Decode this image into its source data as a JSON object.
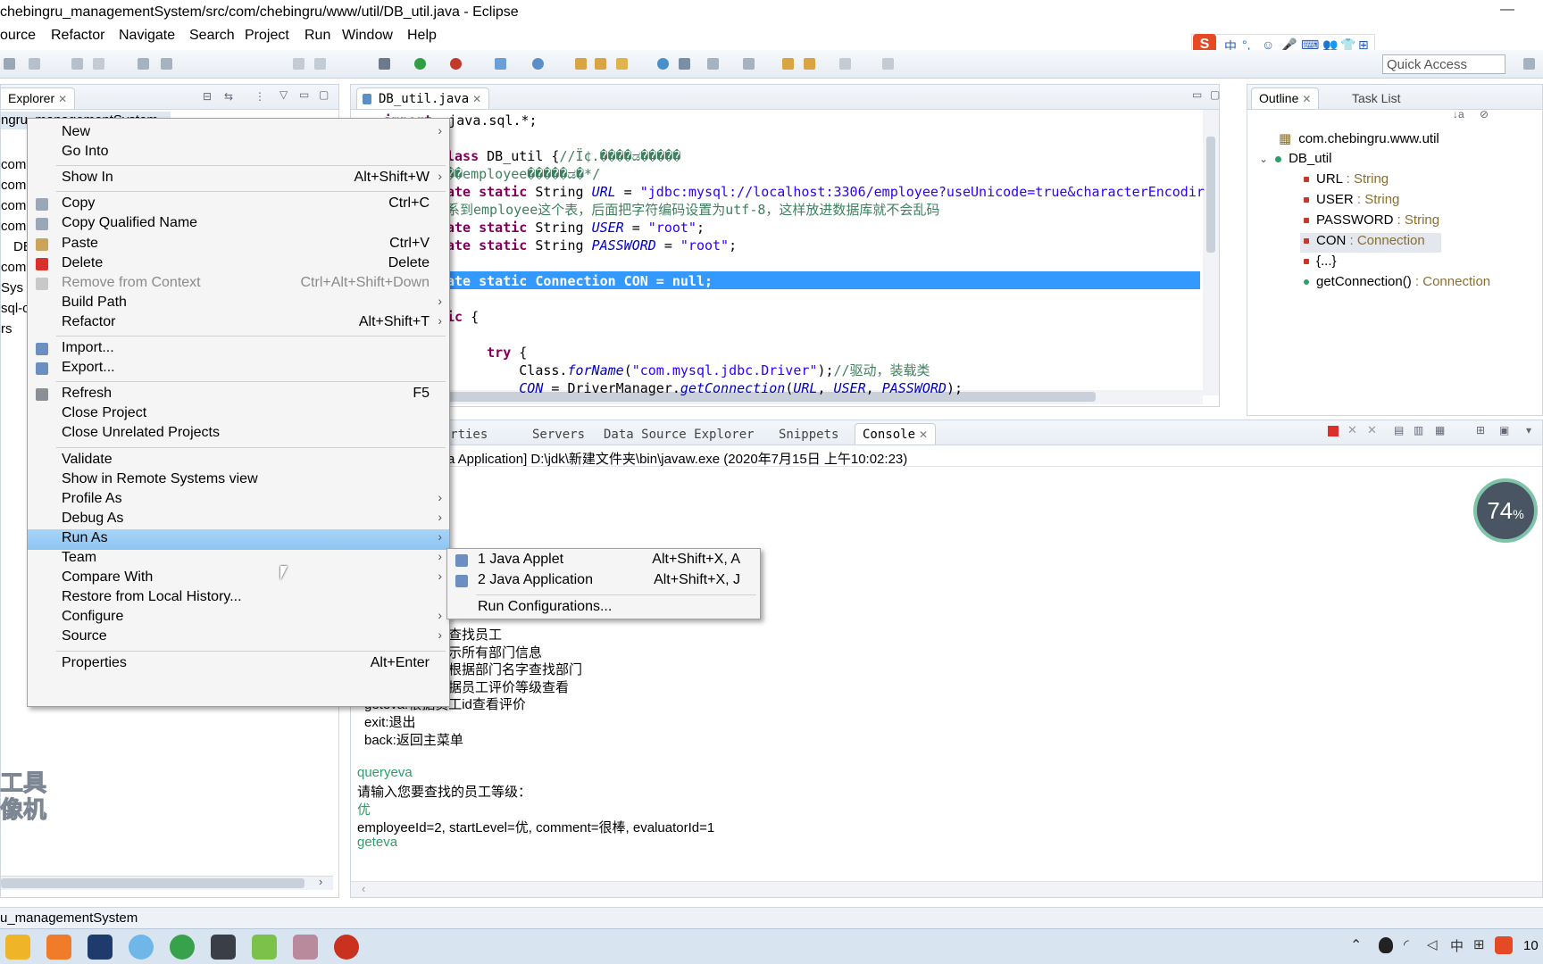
{
  "window": {
    "title": "chebingru_managementSystem/src/com/chebingru/www/util/DB_util.java - Eclipse",
    "minimize": "—"
  },
  "menubar": [
    "ource",
    "Refactor",
    "Navigate",
    "Search",
    "Project",
    "Run",
    "Window",
    "Help"
  ],
  "ime": {
    "logo": "S",
    "items": [
      "中",
      "°,",
      "☺",
      "🎤",
      "⌨",
      "👥",
      "👕",
      "⊞"
    ]
  },
  "toolbar": {
    "quick_access": "Quick Access"
  },
  "explorer": {
    "tab_label": "Explorer",
    "project_item": "ngru_managementSystem",
    "partial_rows": [
      "com.",
      "com.",
      "com.",
      "com.",
      "DB",
      "",
      "com.",
      "Sys",
      "sql-c",
      "",
      "rs"
    ],
    "watermark_line1": "工具",
    "watermark_line2": "像机"
  },
  "editor": {
    "tab_label": "DB_util.java",
    "lines": [
      {
        "parts": [
          [
            "kw",
            "import"
          ],
          [
            "",
            "  java.sql.*;"
          ]
        ]
      },
      {
        "parts": []
      },
      {
        "parts": [
          [
            "kw",
            "lass"
          ],
          [
            "",
            " DB_util {"
          ],
          [
            "cmt",
            "//Ï¢.����ಡ�����"
          ]
        ]
      },
      {
        "parts": [
          [
            "cmt",
            "��employee�����ಡ�*/"
          ]
        ]
      },
      {
        "parts": [
          [
            "kw",
            "ate static"
          ],
          [
            "",
            " String "
          ],
          [
            "fld",
            "URL"
          ],
          [
            "",
            " = "
          ],
          [
            "str",
            "\"jdbc:mysql://localhost:3306/employee?useUnicode=true&characterEncodir"
          ]
        ]
      },
      {
        "parts": [
          [
            "cmt",
            "系到employee这个表，后面把字符编码设置为utf-8，这样放进数据库就不会乱码"
          ]
        ]
      },
      {
        "parts": [
          [
            "kw",
            "ate static"
          ],
          [
            "",
            " String "
          ],
          [
            "fld",
            "USER"
          ],
          [
            "",
            " = "
          ],
          [
            "str",
            "\"root\""
          ],
          [
            "",
            ";"
          ]
        ]
      },
      {
        "parts": [
          [
            "kw",
            "ate static"
          ],
          [
            "",
            " String "
          ],
          [
            "fld",
            "PASSWORD"
          ],
          [
            "",
            " = "
          ],
          [
            "str",
            "\"root\""
          ],
          [
            "",
            ";"
          ]
        ]
      },
      {
        "parts": []
      },
      {
        "parts": [
          [
            "",
            "ate static Connection CON = null;"
          ]
        ]
      },
      {
        "parts": []
      },
      {
        "parts": [
          [
            "kw",
            "ic"
          ],
          [
            "",
            " {"
          ]
        ]
      },
      {
        "parts": []
      },
      {
        "parts": [
          [
            "",
            "     "
          ],
          [
            "kw",
            "try"
          ],
          [
            "",
            " {"
          ]
        ]
      },
      {
        "parts": [
          [
            "",
            "         Class."
          ],
          [
            "fld",
            "forName"
          ],
          [
            "",
            "("
          ],
          [
            "str",
            "\"com.mysql.jdbc.Driver\""
          ],
          [
            "",
            ");"
          ],
          [
            "cmt",
            "//驱动，装载类"
          ]
        ]
      },
      {
        "parts": [
          [
            "",
            "         "
          ],
          [
            "fld",
            "CON"
          ],
          [
            "",
            " = DriverManager."
          ],
          [
            "fld",
            "getConnection"
          ],
          [
            "",
            "("
          ],
          [
            "fld",
            "URL"
          ],
          [
            "",
            ", "
          ],
          [
            "fld",
            "USER"
          ],
          [
            "",
            ", "
          ],
          [
            "fld",
            "PASSWORD"
          ],
          [
            "",
            ");"
          ]
        ]
      }
    ]
  },
  "outline": {
    "tabs": [
      "Outline",
      "Task List"
    ],
    "package": "com.chebingru.www.util",
    "class": "DB_util",
    "members": [
      {
        "name": "URL",
        "type": " : String",
        "color": "#c0392b"
      },
      {
        "name": "USER",
        "type": " : String",
        "color": "#c0392b"
      },
      {
        "name": "PASSWORD",
        "type": " : String",
        "color": "#c0392b"
      },
      {
        "name": "CON",
        "type": " : Connection",
        "color": "#c0392b"
      },
      {
        "name": "{...}",
        "type": "",
        "color": "#c0392b"
      },
      {
        "name": "getConnection()",
        "type": " : Connection",
        "color": "#2ca06a"
      }
    ]
  },
  "console": {
    "tabs": [
      "Properties",
      "Servers",
      "Data Source Explorer",
      "Snippets",
      "Console"
    ],
    "header": "a Application] D:\\jdk\\新建文件夹\\bin\\javaw.exe (2020年7月15日 上午10:02:23)",
    "lines": [
      {
        "text": "查找员工",
        "green": false
      },
      {
        "text": "示所有部门信息",
        "green": false
      },
      {
        "text": "根据部门名字查找部门",
        "green": false
      },
      {
        "text": "据员工评价等级查看",
        "green": false
      },
      {
        "text": "geteva:根据员工id查看评价",
        "green": false
      },
      {
        "text": "exit:退出",
        "green": false
      },
      {
        "text": "back:返回主菜单",
        "green": false
      },
      {
        "text": "",
        "green": false
      },
      {
        "text": "queryeva",
        "green": true
      },
      {
        "text": "请输入您要查找的员工等级：",
        "green": false
      },
      {
        "text": "优",
        "green": true
      },
      {
        "text": "employeeId=2, startLevel=优, comment=很棒, evaluatorId=1",
        "green": false
      },
      {
        "text": "geteva",
        "green": true
      }
    ]
  },
  "context_menu": {
    "items": [
      {
        "label": "New",
        "shortcut": "",
        "submenu": true
      },
      {
        "label": "Go Into",
        "shortcut": ""
      },
      {
        "sep": true
      },
      {
        "label": "Show In",
        "shortcut": "Alt+Shift+W",
        "submenu": true
      },
      {
        "sep": true
      },
      {
        "label": "Copy",
        "shortcut": "Ctrl+C",
        "icon": "copy-icon"
      },
      {
        "label": "Copy Qualified Name",
        "shortcut": "",
        "icon": "copy-qualified-icon"
      },
      {
        "label": "Paste",
        "shortcut": "Ctrl+V",
        "icon": "paste-icon"
      },
      {
        "label": "Delete",
        "shortcut": "Delete",
        "icon": "delete-icon"
      },
      {
        "label": "Remove from Context",
        "shortcut": "Ctrl+Alt+Shift+Down",
        "disabled": true,
        "icon": "remove-context-icon"
      },
      {
        "label": "Build Path",
        "shortcut": "",
        "submenu": true
      },
      {
        "label": "Refactor",
        "shortcut": "Alt+Shift+T",
        "submenu": true
      },
      {
        "sep": true
      },
      {
        "label": "Import...",
        "shortcut": "",
        "icon": "import-icon"
      },
      {
        "label": "Export...",
        "shortcut": "",
        "icon": "export-icon"
      },
      {
        "sep": true
      },
      {
        "label": "Refresh",
        "shortcut": "F5",
        "icon": "refresh-icon"
      },
      {
        "label": "Close Project",
        "shortcut": ""
      },
      {
        "label": "Close Unrelated Projects",
        "shortcut": ""
      },
      {
        "sep": true
      },
      {
        "label": "Validate",
        "shortcut": ""
      },
      {
        "label": "Show in Remote Systems view",
        "shortcut": ""
      },
      {
        "label": "Profile As",
        "shortcut": "",
        "submenu": true
      },
      {
        "label": "Debug As",
        "shortcut": "",
        "submenu": true
      },
      {
        "label": "Run As",
        "shortcut": "",
        "submenu": true,
        "highlight": true
      },
      {
        "label": "Team",
        "shortcut": "",
        "submenu": true
      },
      {
        "label": "Compare With",
        "shortcut": "",
        "submenu": true
      },
      {
        "label": "Restore from Local History...",
        "shortcut": ""
      },
      {
        "label": "Configure",
        "shortcut": "",
        "submenu": true
      },
      {
        "label": "Source",
        "shortcut": "",
        "submenu": true
      },
      {
        "sep": true
      },
      {
        "label": "Properties",
        "shortcut": "Alt+Enter"
      }
    ]
  },
  "run_as_submenu": [
    {
      "label": "1 Java Applet",
      "shortcut": "Alt+Shift+X, A",
      "icon": "java-applet-icon"
    },
    {
      "label": "2 Java Application",
      "shortcut": "Alt+Shift+X, J",
      "icon": "java-application-icon"
    },
    {
      "sep": true
    },
    {
      "label": "Run Configurations...",
      "shortcut": ""
    }
  ],
  "status_bar": {
    "text": "u_managementSystem"
  },
  "system": {
    "badge": "74",
    "badge_unit": "%",
    "clock_partial": "10"
  }
}
